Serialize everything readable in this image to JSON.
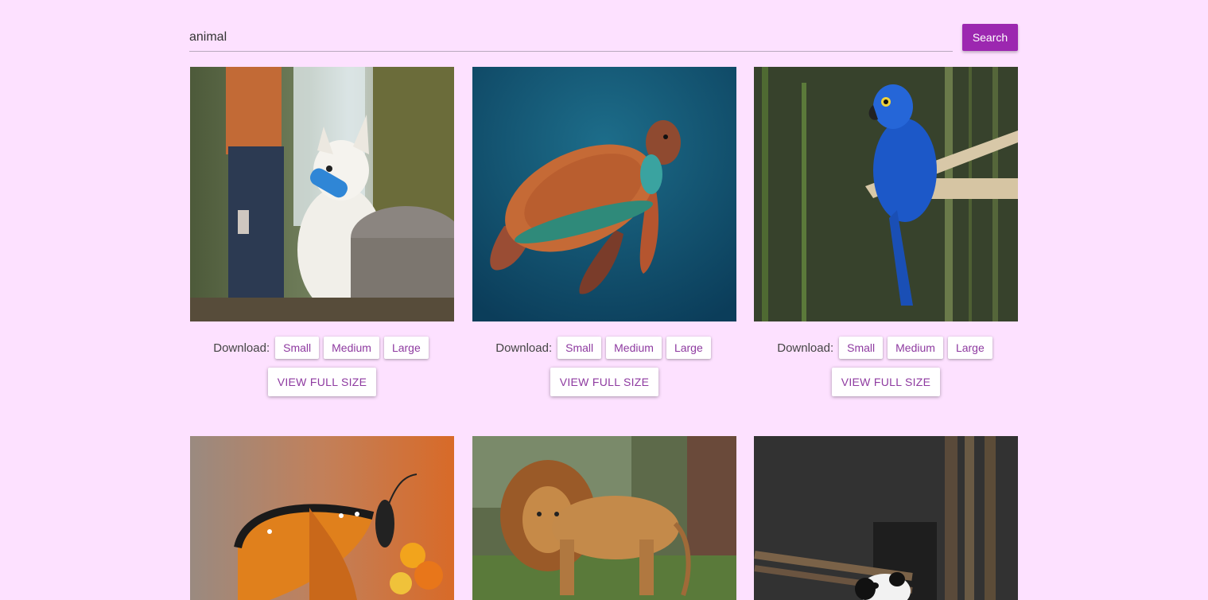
{
  "search": {
    "value": "animal",
    "button_label": "Search"
  },
  "labels": {
    "download": "Download:",
    "small": "Small",
    "medium": "Medium",
    "large": "Large",
    "view_full": "VIEW FULL SIZE"
  },
  "images": [
    {
      "subject": "dog"
    },
    {
      "subject": "sea turtle"
    },
    {
      "subject": "blue macaw"
    },
    {
      "subject": "butterfly"
    },
    {
      "subject": "lion"
    },
    {
      "subject": "panda"
    }
  ],
  "colors": {
    "background": "#fde1ff",
    "accent": "#9c27b0",
    "button_text": "#8e3aa0"
  }
}
